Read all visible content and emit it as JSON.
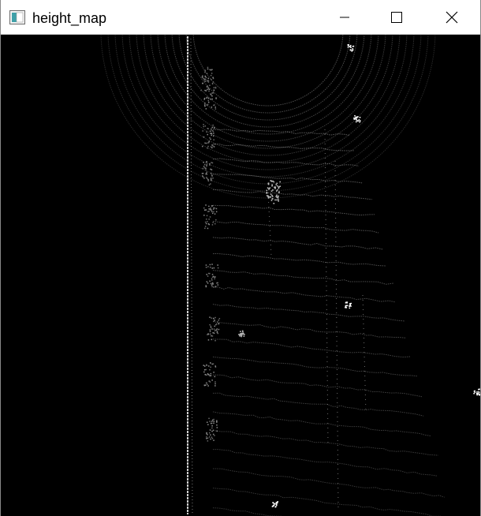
{
  "window": {
    "title": "height_map",
    "icon": "window-app-icon",
    "controls": {
      "minimize_icon": "minimize-icon",
      "maximize_icon": "maximize-icon",
      "close_icon": "close-icon"
    }
  },
  "image": {
    "description_icon": "height-map-image",
    "background_color": "#000000",
    "point_color_low": "#555555",
    "point_color_high": "#ffffff"
  }
}
